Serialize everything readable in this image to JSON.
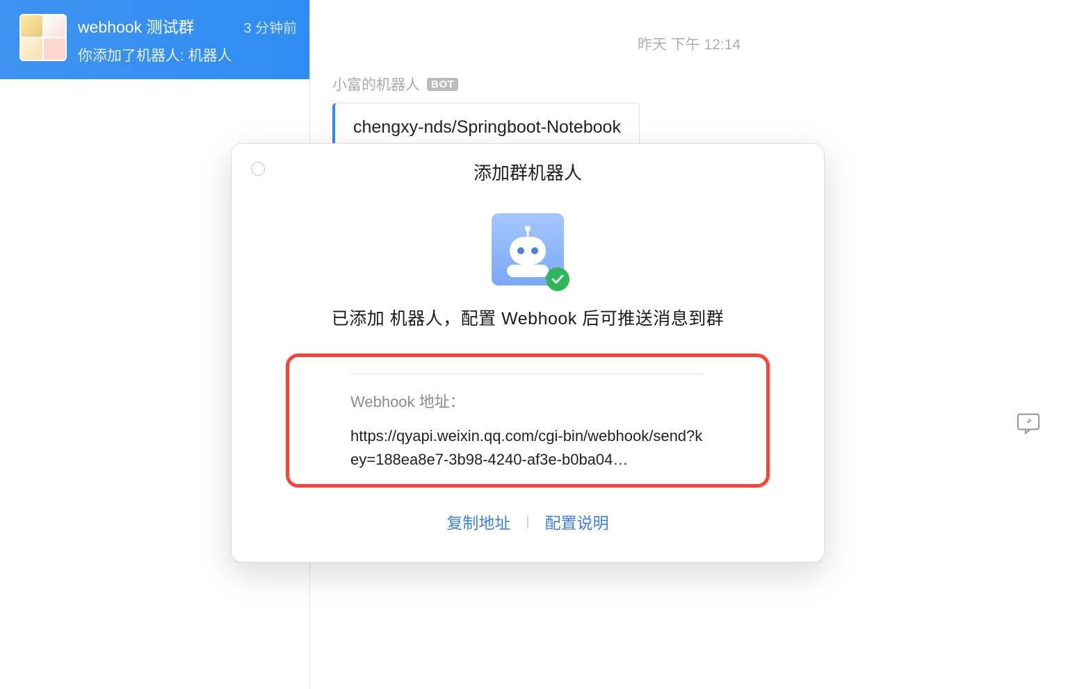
{
  "sidebar": {
    "active_chat": {
      "title": "webhook 测试群",
      "time": "3 分钟前",
      "preview": "你添加了机器人: 机器人"
    }
  },
  "main": {
    "timestamp": "昨天 下午 12:14",
    "message": {
      "sender": "小富的机器人",
      "badge": "BOT",
      "content": "chengxy-nds/Springboot-Notebook"
    }
  },
  "modal": {
    "title": "添加群机器人",
    "description": "已添加 机器人，配置 Webhook 后可推送消息到群",
    "webhook_label": "Webhook 地址：",
    "webhook_url": "https://qyapi.weixin.qq.com/cgi-bin/webhook/send?key=188ea8e7-3b98-4240-af3e-b0ba04…",
    "actions": {
      "copy": "复制地址",
      "guide": "配置说明"
    }
  }
}
